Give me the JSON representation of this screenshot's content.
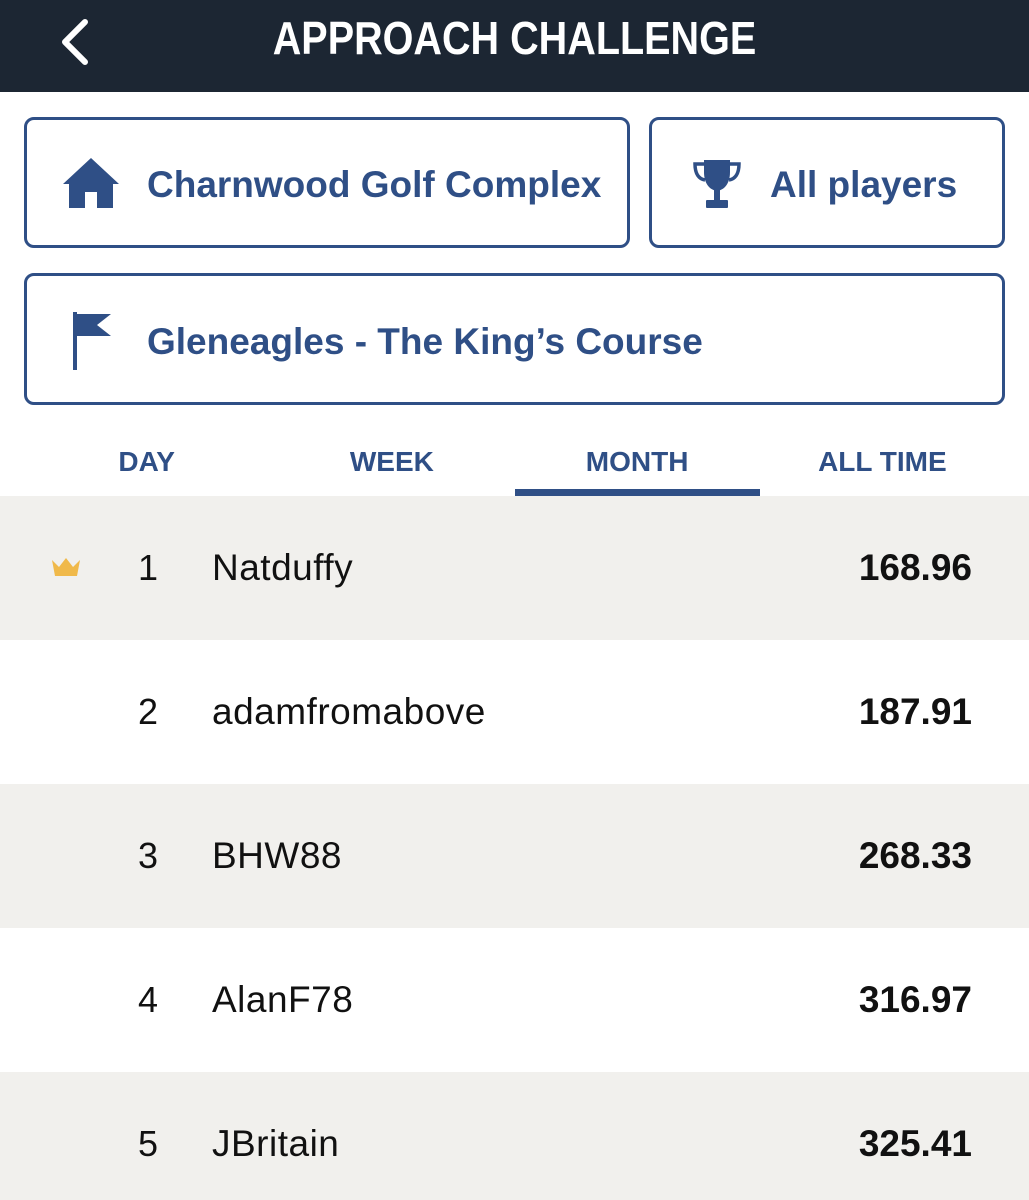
{
  "header": {
    "title": "APPROACH CHALLENGE",
    "back_icon": "chevron-left-icon"
  },
  "filters": {
    "venue": {
      "label": "Charnwood Golf Complex",
      "icon": "home-icon"
    },
    "players": {
      "label": "All players",
      "icon": "trophy-icon"
    },
    "course": {
      "label": "Gleneagles - The King’s Course",
      "icon": "flag-icon"
    }
  },
  "tabs": [
    {
      "label": "DAY",
      "active": false
    },
    {
      "label": "WEEK",
      "active": false
    },
    {
      "label": "MONTH",
      "active": true
    },
    {
      "label": "ALL TIME",
      "active": false
    }
  ],
  "leaderboard": [
    {
      "rank": "1",
      "name": "Natduffy",
      "score": "168.96",
      "leader_icon": "crown-icon"
    },
    {
      "rank": "2",
      "name": "adamfromabove",
      "score": "187.91"
    },
    {
      "rank": "3",
      "name": "BHW88",
      "score": "268.33"
    },
    {
      "rank": "4",
      "name": "AlanF78",
      "score": "316.97"
    },
    {
      "rank": "5",
      "name": "JBritain",
      "score": "325.41"
    }
  ],
  "colors": {
    "header_bg": "#1c2633",
    "accent": "#2f4f86",
    "row_shade": "#f1f0ed",
    "crown": "#f0b94a"
  }
}
